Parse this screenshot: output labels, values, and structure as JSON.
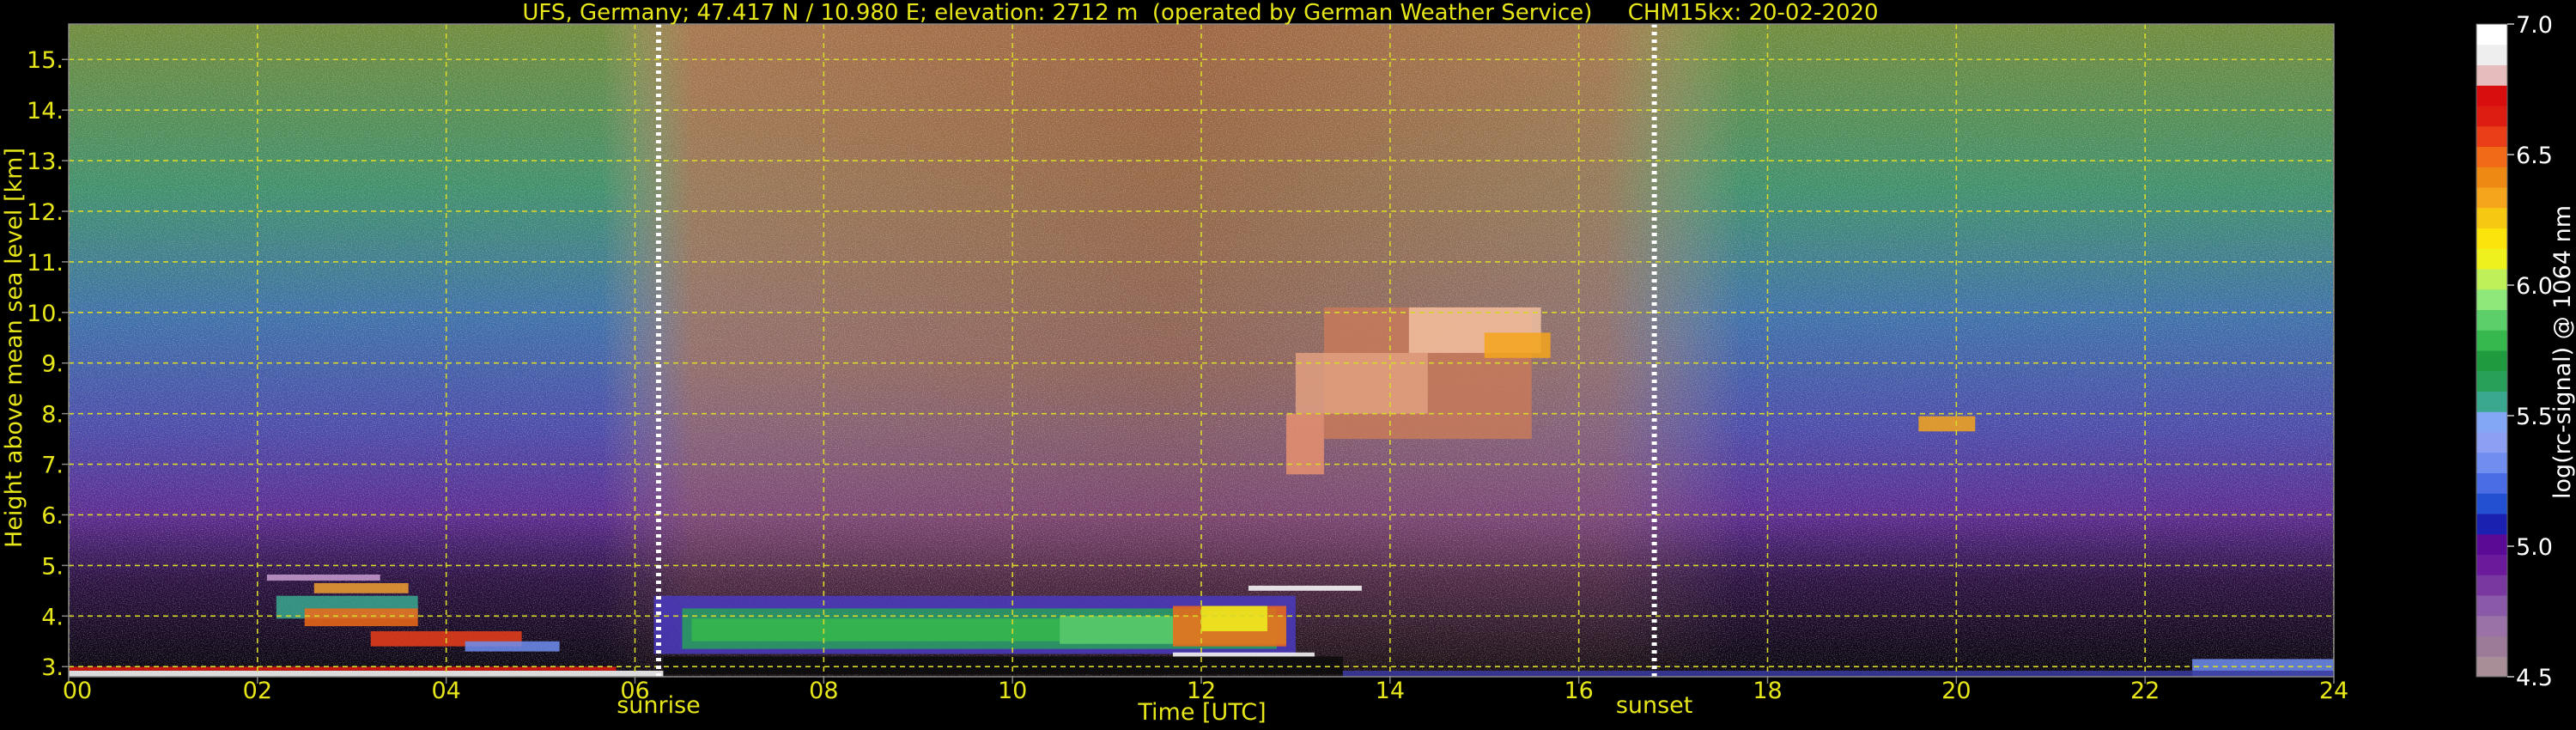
{
  "chart_data": {
    "type": "heatmap",
    "title": "UFS, Germany; 47.417 N / 10.980 E; elevation: 2712 m  (operated by German Weather Service)     CHM15kx: 20-02-2020",
    "xlabel": "Time [UTC]",
    "ylabel": "Height above mean sea level [km]",
    "xlim": [
      0,
      24
    ],
    "ylim": [
      2.8,
      15.7
    ],
    "x_ticks": [
      "00",
      "02",
      "04",
      "06",
      "08",
      "10",
      "12",
      "14",
      "16",
      "18",
      "20",
      "22",
      "24"
    ],
    "y_ticks": [
      "3.",
      "4.",
      "5.",
      "6.",
      "7.",
      "8.",
      "9.",
      "10.",
      "11.",
      "12.",
      "13.",
      "14.",
      "15."
    ],
    "grid": true,
    "markers": [
      {
        "label": "sunrise",
        "time": 6.25
      },
      {
        "label": "sunset",
        "time": 16.8
      }
    ],
    "colorbar": {
      "label": "log(rc-signal) @ 1064 nm",
      "range": [
        4.5,
        7.0
      ],
      "ticks": [
        "4.5",
        "5.0",
        "5.5",
        "6.0",
        "6.5",
        "7.0"
      ],
      "colors": [
        "#a88f97",
        "#9b7b98",
        "#9a72a8",
        "#8a5aa8",
        "#79389f",
        "#6a1a9a",
        "#5a0a95",
        "#1a20b0",
        "#2350d0",
        "#4a6de6",
        "#6f8ef0",
        "#8d9ff3",
        "#83a7f4",
        "#3aa88f",
        "#28a05a",
        "#1f9a3f",
        "#36b84c",
        "#5ccf6a",
        "#8ee87a",
        "#bff05a",
        "#eef11e",
        "#fbe40b",
        "#f6c812",
        "#f5a51c",
        "#ee8a14",
        "#f06a17",
        "#ea3e19",
        "#dd1c12",
        "#d80d0d",
        "#e6bcbc",
        "#eeeeee",
        "#ffffff"
      ]
    }
  },
  "colors": {
    "axis_text": "#e6e61a",
    "grid": "#d8d82a",
    "frame": "#888888",
    "colorbar_text": "#ffffff"
  }
}
